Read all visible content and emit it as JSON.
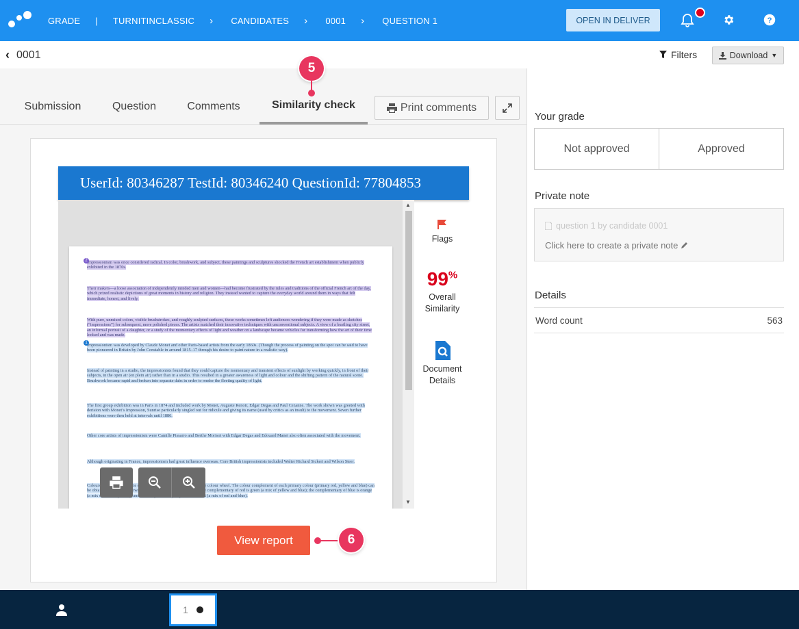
{
  "topbar": {
    "crumbs": [
      "GRADE",
      "TURNITINCLASSIC",
      "CANDIDATES",
      "0001",
      "QUESTION 1"
    ],
    "open_in_deliver": "OPEN IN DELIVER",
    "icons": [
      "logo-icon",
      "bell-icon",
      "gear-icon",
      "help-icon"
    ],
    "accent": "#1e90f0"
  },
  "subbar": {
    "back_label": "0001",
    "filters_label": "Filters",
    "download_label": "Download"
  },
  "tabs": [
    {
      "label": "Submission"
    },
    {
      "label": "Question"
    },
    {
      "label": "Comments"
    },
    {
      "label": "Similarity check",
      "active": true
    }
  ],
  "print_comments": "Print comments",
  "viewer": {
    "header": "UserId: 80346287 TestId: 80346240 QuestionId: 77804853",
    "paragraphs": [
      {
        "badge": "2",
        "text": "Impressionism was once considered radical. In color, brushwork, and subject, these paintings and sculptures shocked the French art establishment when publicly exhibited in the 1870s."
      },
      {
        "text": "Their makers—a loose association of independently minded men and women—had become frustrated by the rules and traditions of the official French art of the day, which prized realistic depictions of great moments in history and religion. They instead wanted to capture the everyday world around them in ways that felt immediate, honest, and lively."
      },
      {
        "text": "With pure, unmixed colors, visible brushstrokes, and roughly sculpted surfaces, these works sometimes left audiences wondering if they were made as sketches (“impressions”) for subsequent, more polished pieces. The artists matched their innovative techniques with unconventional subjects. A view of a bustling city street, an informal portrait of a daughter, or a study of the momentary effects of light and weather on a landscape became vehicles for transforming how the art of their time looked and was made."
      },
      {
        "badge": "1",
        "text": "Impressionism was developed by Claude Monet and other Paris-based artists from the early 1860s. (Though the process of painting on the spot can be said to have been pioneered in Britain by John Constable in around 1815–17 through his desire to paint nature in a realistic way)."
      },
      {
        "text": "Instead of painting in a studio, the impressionists found that they could capture the momentary and transient effects of sunlight by working quickly, in front of their subjects, in the open air (en plein air) rather than in a studio. This resulted in a greater awareness of light and colour and the shifting pattern of the natural scene. Brushwork became rapid and broken into separate dabs in order to render the fleeting quality of light."
      },
      {
        "text": "The first group exhibition was in Paris in 1874 and included work by Monet, Auguste Renoir, Edgar Degas and Paul Cezanne. The work shown was greeted with derision with Monet’s Impression, Sunrise particularly singled out for ridicule and giving its name (used by critics as an insult) to the movement. Seven further exhibitions were then held at intervals until 1886."
      },
      {
        "text": "Other core artists of impressionism were Camille Pissarro and Berthe Morisot with Edgar Degas and Edouard Manet also often associated with the movement."
      },
      {
        "text": "Although originating in France, impressionism had great influence overseas. Core British impressionists included Walter Richard Sickert and Wilson Steer."
      },
      {
        "text": "Colours that appear opposite each other on colour models such as the colour wheel. The colour complement of each primary colour (primary red, yellow and blue) can be obtained by mixing the two other primary colours together. So the complementary of red is green (a mix of yellow and blue); the complementary of blue is orange (a mix of red and yellow); and the complementary of yellow is violet (a mix of red and blue)."
      }
    ],
    "tools": [
      "print-icon",
      "zoom-out-icon",
      "zoom-in-icon"
    ]
  },
  "rail": {
    "flags_label": "Flags",
    "similarity_value": "99",
    "similarity_unit": "%",
    "similarity_label_1": "Overall",
    "similarity_label_2": "Similarity",
    "doc_details_1": "Document",
    "doc_details_2": "Details",
    "similarity_color": "#d9001b"
  },
  "view_report": "View report",
  "markers": [
    "5",
    "6"
  ],
  "right": {
    "grade_label": "Your grade",
    "not_approved": "Not approved",
    "approved": "Approved",
    "private_note_label": "Private note",
    "note_title": "question 1 by candidate 0001",
    "note_cta": "Click here to create a private note",
    "details_label": "Details",
    "word_count_label": "Word count",
    "word_count_value": "563"
  },
  "footer": {
    "page_number": "1"
  }
}
